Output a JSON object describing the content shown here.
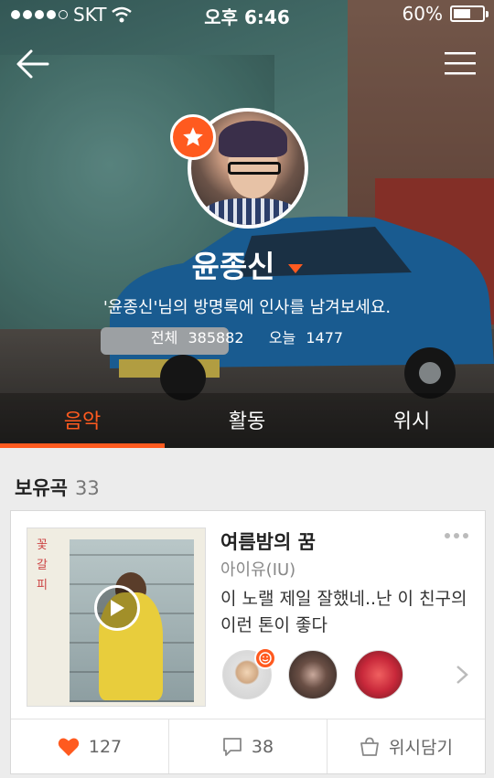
{
  "status_bar": {
    "carrier": "SKT",
    "time": "오후 6:46",
    "battery": "60%",
    "battery_level": 0.6
  },
  "profile": {
    "name": "윤종신",
    "guestbook_prompt": "'윤종신'님의 방명록에 인사를 남겨보세요.",
    "total_label": "전체",
    "total_count": "385882",
    "today_label": "오늘",
    "today_count": "1477"
  },
  "tabs": [
    {
      "label": "음악",
      "active": true
    },
    {
      "label": "활동",
      "active": false
    },
    {
      "label": "위시",
      "active": false
    }
  ],
  "section": {
    "title": "보유곡",
    "count": "33"
  },
  "song_card": {
    "title": "여름밤의 꿈",
    "artist": "아이유(IU)",
    "comment": "이 노랠 제일 잘했네..난 이 친구의 이런 톤이 좋다",
    "album_text": "꽃 갈 피",
    "likes": "127",
    "comments": "38",
    "wish_label": "위시담기"
  },
  "colors": {
    "accent": "#ff5a1f"
  }
}
